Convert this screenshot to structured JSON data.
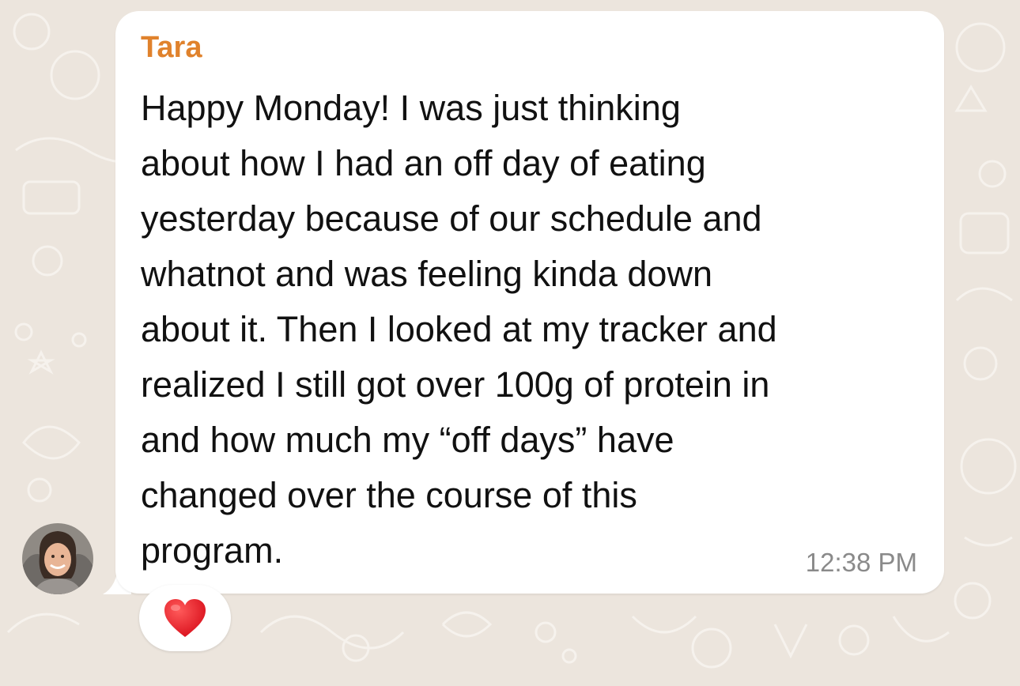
{
  "chat": {
    "background_color": "#ece5dd",
    "bubble_color": "#ffffff"
  },
  "message": {
    "sender": "Tara",
    "sender_color": "#e0822c",
    "lines": [
      "Happy Monday! I was just thinking",
      "about how I had an off day of eating",
      "yesterday because of our schedule and",
      "whatnot and was feeling kinda down",
      "about it. Then I looked at my tracker and",
      "realized I still got over 100g of protein in",
      "and how much my “off days” have",
      "changed over the course of this",
      "program."
    ],
    "time": "12:38 PM"
  },
  "avatar": {
    "icon": "profile-photo-icon"
  },
  "reaction": {
    "icon": "red-heart-icon"
  }
}
